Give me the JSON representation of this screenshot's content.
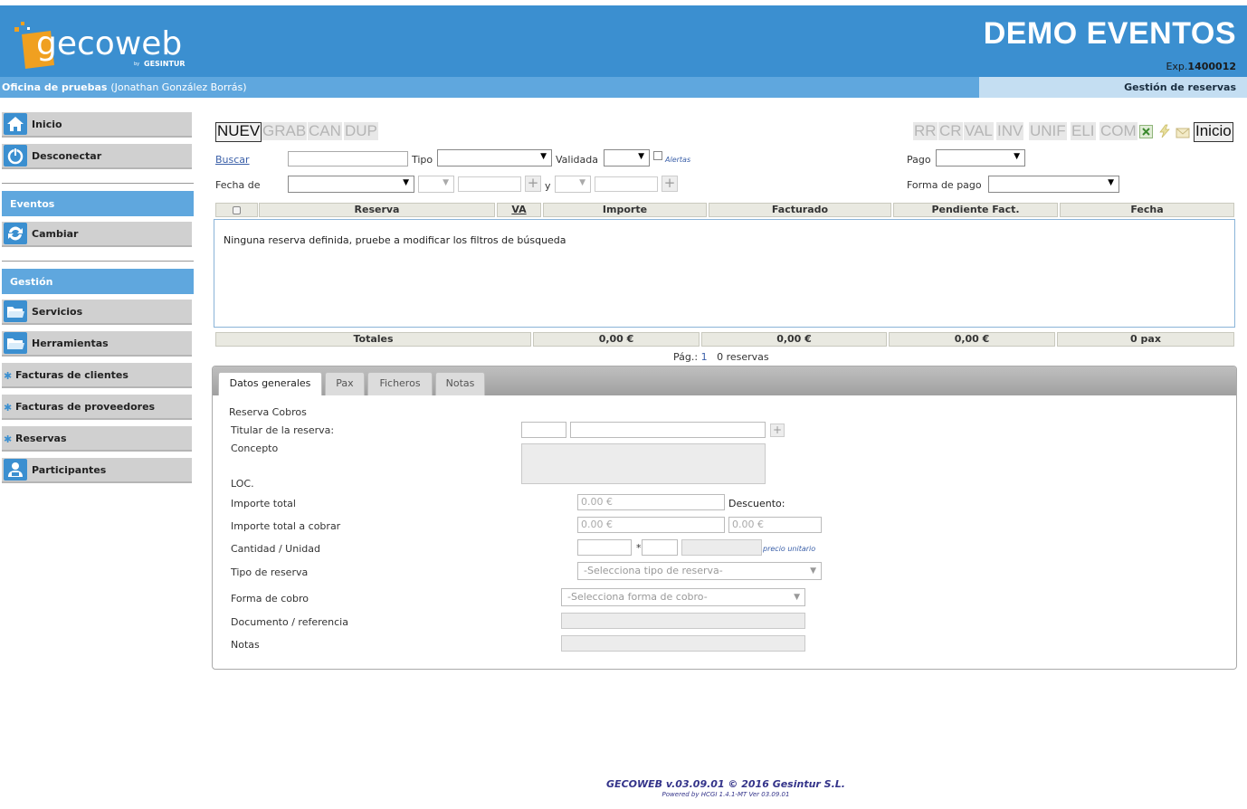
{
  "header": {
    "logo_text": "gecoweb",
    "logo_sub": "by GESINTUR",
    "app_title": "DEMO EVENTOS",
    "exp_label": "Exp.",
    "exp_number": "1400012",
    "brand_color": "#3b8fd0"
  },
  "subbar": {
    "office": "Oficina de pruebas",
    "user": "(Jonathan González Borrás)",
    "module": "Gestión de reservas"
  },
  "sidebar": {
    "top": [
      {
        "label": "Inicio",
        "icon": "home-icon"
      },
      {
        "label": "Desconectar",
        "icon": "power-icon"
      }
    ],
    "events_header": "Eventos",
    "events_items": [
      {
        "label": "Cambiar",
        "icon": "refresh-icon"
      }
    ],
    "gestion_header": "Gestión",
    "gestion_items": [
      {
        "label": "Servicios",
        "icon": "folder-icon"
      },
      {
        "label": "Herramientas",
        "icon": "folder-icon"
      },
      {
        "label": "Facturas de clientes",
        "icon": "star-icon"
      },
      {
        "label": "Facturas de proveedores",
        "icon": "star-icon"
      },
      {
        "label": "Reservas",
        "icon": "star-icon"
      },
      {
        "label": "Participantes",
        "icon": "user-icon"
      }
    ]
  },
  "toolbar": {
    "left": [
      "NUEV",
      "GRAB",
      "CAN",
      "DUP"
    ],
    "right": [
      "RR",
      "CR",
      "VAL",
      "INV",
      "UNIF",
      "ELI",
      "COM"
    ],
    "inicio": "Inicio"
  },
  "filters": {
    "buscar": "Buscar",
    "tipo": "Tipo",
    "validada": "Validada",
    "alertas": "Alertas",
    "pago": "Pago",
    "fecha_de": "Fecha de",
    "y": "y",
    "forma_de_pago": "Forma de pago"
  },
  "grid": {
    "columns": [
      "Reserva",
      "VA",
      "Importe",
      "Facturado",
      "Pendiente Fact.",
      "Fecha"
    ],
    "empty_message": "Ninguna reserva definida, pruebe a modificar los filtros de búsqueda",
    "totals": [
      "Totales",
      "0,00 €",
      "0,00 €",
      "0,00 €",
      "0 pax"
    ],
    "pager_label": "Pág.:",
    "pager_page": "1",
    "pager_count": "0 reservas"
  },
  "detail": {
    "tabs": [
      "Datos generales",
      "Pax",
      "Ficheros",
      "Notas"
    ],
    "section_title": "Reserva Cobros",
    "titular": "Titular de la reserva:",
    "concepto": "Concepto",
    "loc": "LOC.",
    "importe_total": "Importe total",
    "importe_total_value": "0.00 €",
    "descuento": "Descuento:",
    "importe_cobrar": "Importe total a cobrar",
    "importe_cobrar_value": "0.00 €",
    "descuento_value": "0.00 €",
    "cantidad": "Cantidad / Unidad",
    "multiply": "*",
    "precio_unitario": "precio unitario",
    "tipo_reserva": "Tipo de reserva",
    "tipo_reserva_placeholder": "-Selecciona tipo de reserva-",
    "forma_cobro": "Forma de cobro",
    "forma_cobro_placeholder": "-Selecciona forma de cobro-",
    "documento": "Documento / referencia",
    "notas": "Notas"
  },
  "footer": {
    "line1": "GECOWEB v.03.09.01 © 2016 Gesintur S.L.",
    "line2": "Powered by HCGI 1.4.1-MT Ver 03.09.01"
  }
}
